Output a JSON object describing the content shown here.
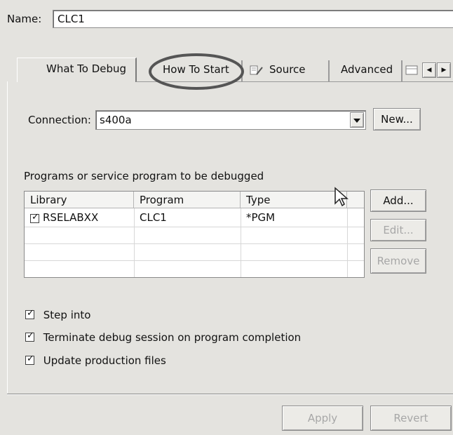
{
  "name_field": {
    "label": "Name:",
    "value": "CLC1"
  },
  "tabs": [
    {
      "label": "What To Debug",
      "active": true
    },
    {
      "label": "How To Start",
      "highlighted": true
    },
    {
      "label": "Source",
      "icon": "source-icon"
    },
    {
      "label": "Advanced"
    }
  ],
  "tab_scroll": {
    "left": "◀",
    "right": "▶"
  },
  "connection": {
    "label": "Connection:",
    "value": "s400a",
    "new_button": "New..."
  },
  "programs": {
    "caption": "Programs or service program to be debugged",
    "columns": [
      "Library",
      "Program",
      "Type"
    ],
    "rows": [
      {
        "checked": true,
        "library": "RSELABXX",
        "program": "CLC1",
        "type": "*PGM"
      }
    ],
    "buttons": {
      "add": "Add...",
      "edit": "Edit...",
      "remove": "Remove"
    }
  },
  "options": [
    {
      "label": "Step into",
      "checked": true
    },
    {
      "label": "Terminate debug session on program completion",
      "checked": true
    },
    {
      "label": "Update production files",
      "checked": true
    }
  ],
  "footer": {
    "apply": "Apply",
    "revert": "Revert"
  }
}
